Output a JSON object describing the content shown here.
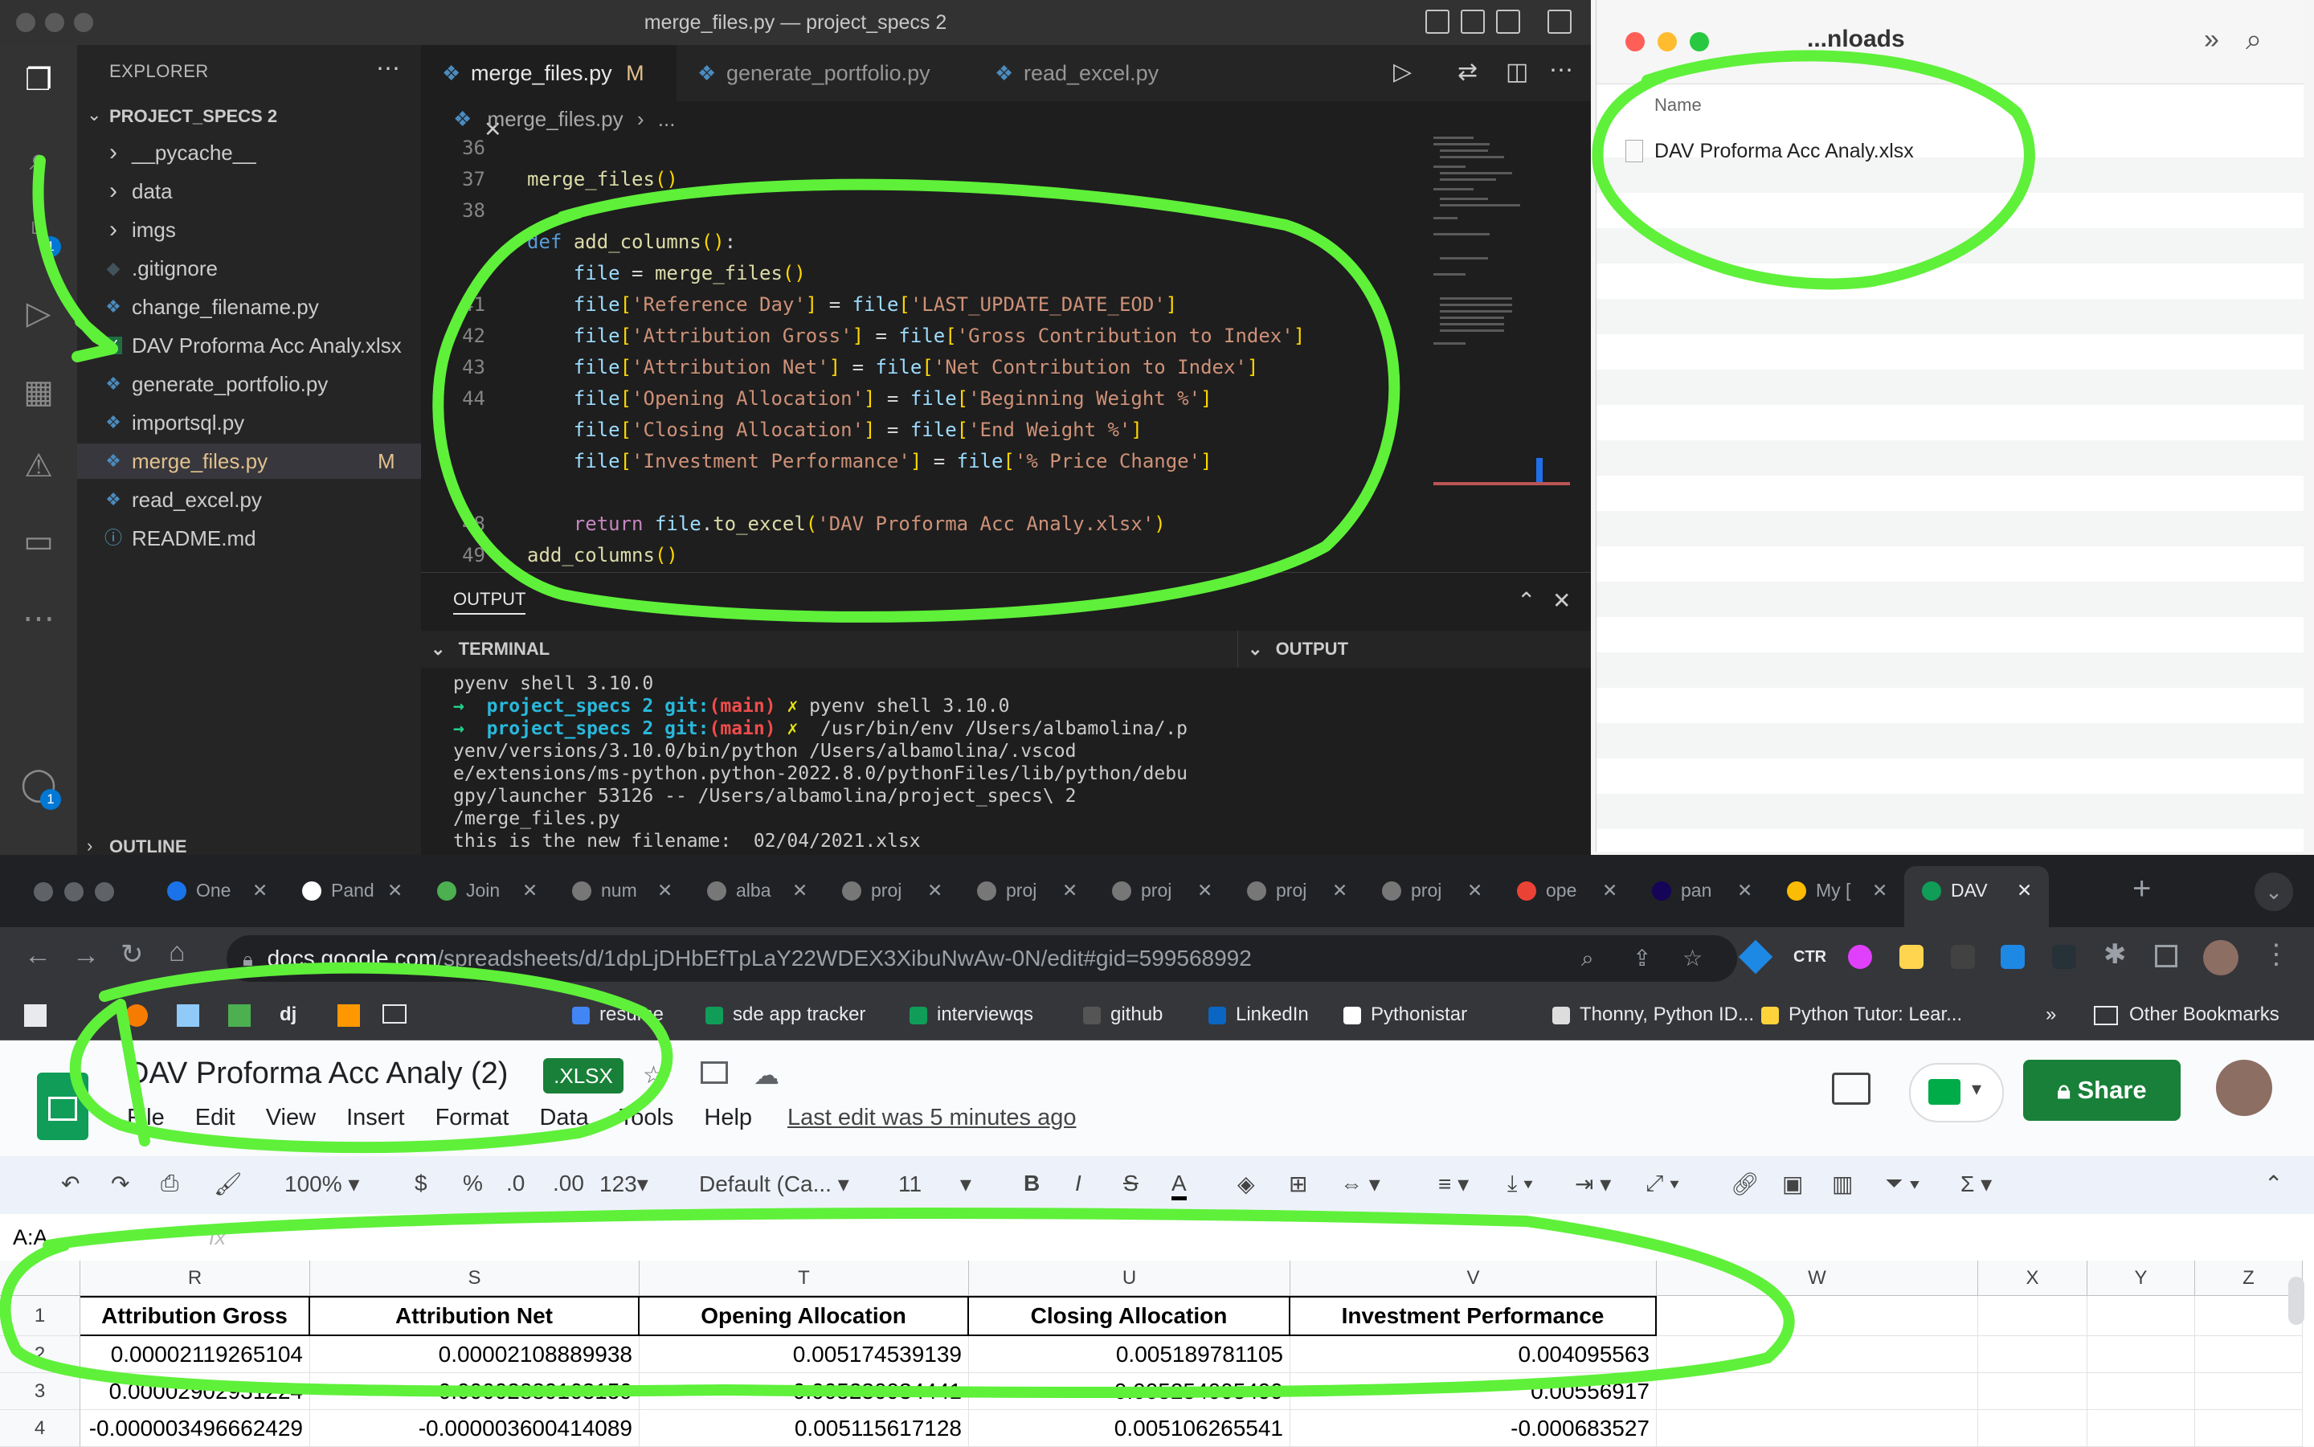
{
  "vscode": {
    "window_title": "merge_files.py — project_specs 2",
    "explorer_label": "EXPLORER",
    "project": "PROJECT_SPECS 2",
    "tree": [
      {
        "label": "__pycache__",
        "type": "folder"
      },
      {
        "label": "data",
        "type": "folder"
      },
      {
        "label": "imgs",
        "type": "folder"
      },
      {
        "label": ".gitignore",
        "type": "file",
        "icon": "git-icon"
      },
      {
        "label": "change_filename.py",
        "type": "file",
        "icon": "python-icon"
      },
      {
        "label": "DAV Proforma Acc Analy.xlsx",
        "type": "file",
        "icon": "excel-icon"
      },
      {
        "label": "generate_portfolio.py",
        "type": "file",
        "icon": "python-icon"
      },
      {
        "label": "importsql.py",
        "type": "file",
        "icon": "python-icon"
      },
      {
        "label": "merge_files.py",
        "type": "file",
        "icon": "python-icon",
        "status": "M",
        "selected": true
      },
      {
        "label": "read_excel.py",
        "type": "file",
        "icon": "python-icon"
      },
      {
        "label": "README.md",
        "type": "file",
        "icon": "info-icon"
      }
    ],
    "outline_label": "OUTLINE",
    "activity_badges": {
      "source_control": "1",
      "accounts": "1"
    },
    "tabs": [
      {
        "label": "merge_files.py",
        "modified": "M",
        "active": true
      },
      {
        "label": "generate_portfolio.py"
      },
      {
        "label": "read_excel.py"
      }
    ],
    "breadcrumb": [
      "merge_files.py",
      "..."
    ],
    "code_lines": [
      {
        "n": "36",
        "text": ""
      },
      {
        "n": "37",
        "text": "merge_files()"
      },
      {
        "n": "38",
        "text": ""
      },
      {
        "n": "",
        "text": "def add_columns():"
      },
      {
        "n": "",
        "text": "    file = merge_files()"
      },
      {
        "n": "41",
        "text": "    file['Reference Day'] = file['LAST_UPDATE_DATE_EOD']"
      },
      {
        "n": "42",
        "text": "    file['Attribution Gross'] = file['Gross Contribution to Index']"
      },
      {
        "n": "43",
        "text": "    file['Attribution Net'] = file['Net Contribution to Index']"
      },
      {
        "n": "44",
        "text": "    file['Opening Allocation'] = file['Beginning Weight %']"
      },
      {
        "n": "",
        "text": "    file['Closing Allocation'] = file['End Weight %']"
      },
      {
        "n": "",
        "text": "    file['Investment Performance'] = file['% Price Change']"
      },
      {
        "n": "",
        "text": ""
      },
      {
        "n": "48",
        "text": "    return file.to_excel('DAV Proforma Acc Analy.xlsx')"
      },
      {
        "n": "49",
        "text": "add_columns()"
      },
      {
        "n": "50",
        "text": ""
      }
    ],
    "panel_label": "OUTPUT",
    "terminal_label": "TERMINAL",
    "output_label": "OUTPUT",
    "terminal_lines": [
      "pyenv shell 3.10.0",
      "→  project_specs 2 git:(main) ✗ pyenv shell 3.10.0",
      "→  project_specs 2 git:(main) ✗  /usr/bin/env /Users/albamolina/.p",
      "yenv/versions/3.10.0/bin/python /Users/albamolina/.vscod",
      "e/extensions/ms-python.python-2022.8.0/pythonFiles/lib/python/debu",
      "gpy/launcher 53126 -- /Users/albamolina/project_specs\\ 2",
      "/merge_files.py",
      "this is the new filename:  02/04/2021.xlsx"
    ]
  },
  "finder": {
    "title": "...nloads",
    "column_name": "Name",
    "file": "DAV Proforma Acc Analy.xlsx"
  },
  "chrome": {
    "tabs": [
      {
        "label": "One",
        "color": "#1a73e8"
      },
      {
        "label": "Pand",
        "color": "#ffffff"
      },
      {
        "label": "Join",
        "color": "#4caf50"
      },
      {
        "label": "num",
        "color": "#777777"
      },
      {
        "label": "alba",
        "color": "#777777"
      },
      {
        "label": "proj",
        "color": "#777777"
      },
      {
        "label": "proj",
        "color": "#777777"
      },
      {
        "label": "proj",
        "color": "#777777"
      },
      {
        "label": "proj",
        "color": "#777777"
      },
      {
        "label": "proj",
        "color": "#777777"
      },
      {
        "label": "ope",
        "color": "#ea4335"
      },
      {
        "label": "pan",
        "color": "#150458"
      },
      {
        "label": "My [",
        "color": "#fbbc04"
      },
      {
        "label": "DAV",
        "color": "#0f9d58",
        "active": true
      }
    ],
    "url_domain": "docs.google.com",
    "url_path": "/spreadsheets/d/1dpLjDHbEfTpLaY22WDEX3XibuNwAw-0N/edit#gid=599568992",
    "bookmarks": [
      {
        "label": "resume",
        "color": "#4285f4"
      },
      {
        "label": "sde app tracker",
        "color": "#0f9d58"
      },
      {
        "label": "interviewqs",
        "color": "#0f9d58"
      },
      {
        "label": "github",
        "color": "#555555"
      },
      {
        "label": "LinkedIn",
        "color": "#0a66c2"
      },
      {
        "label": "Pythonistar",
        "color": "#ffffff"
      },
      {
        "label": "Thonny, Python ID...",
        "color": "#dddddd"
      },
      {
        "label": "Python Tutor: Lear...",
        "color": "#ffd43b"
      }
    ],
    "overflow": "»",
    "other_bookmarks": "Other Bookmarks"
  },
  "sheets": {
    "title": "DAV Proforma Acc Analy (2)",
    "badge": ".XLSX",
    "menu": [
      "File",
      "Edit",
      "View",
      "Insert",
      "Format",
      "Data",
      "Tools",
      "Help"
    ],
    "last_edit": "Last edit was 5 minutes ago",
    "share": "Share",
    "toolbar": {
      "zoom": "100%",
      "currency": "$",
      "percent": "%",
      "dec_less": ".0",
      "dec_more": ".00",
      "format": "123",
      "font": "Default (Ca...",
      "size": "11",
      "bold": "B",
      "italic": "I",
      "strike": "S",
      "text_color": "A"
    },
    "name_box": "A:A",
    "fx": "fx",
    "columns": [
      "R",
      "S",
      "T",
      "U",
      "V",
      "W",
      "X",
      "Y",
      "Z"
    ],
    "rows": [
      "1",
      "2",
      "3",
      "4"
    ],
    "headers": [
      "Attribution Gross",
      "Attribution Net",
      "Opening Allocation",
      "Closing Allocation",
      "Investment Performance"
    ],
    "data": [
      [
        "0.00002119265104",
        "0.00002108889938",
        "0.005174539139",
        "0.005189781105",
        "0.004095563"
      ],
      [
        "0.00002902931224",
        "0.00002889163159",
        "0.005230934441",
        "0.005254005499",
        "0.00556917"
      ],
      [
        "-0.000003496662429",
        "-0.000003600414089",
        "0.005115617128",
        "0.005106265541",
        "-0.000683527"
      ]
    ]
  },
  "annotation_color": "#5ff03a"
}
